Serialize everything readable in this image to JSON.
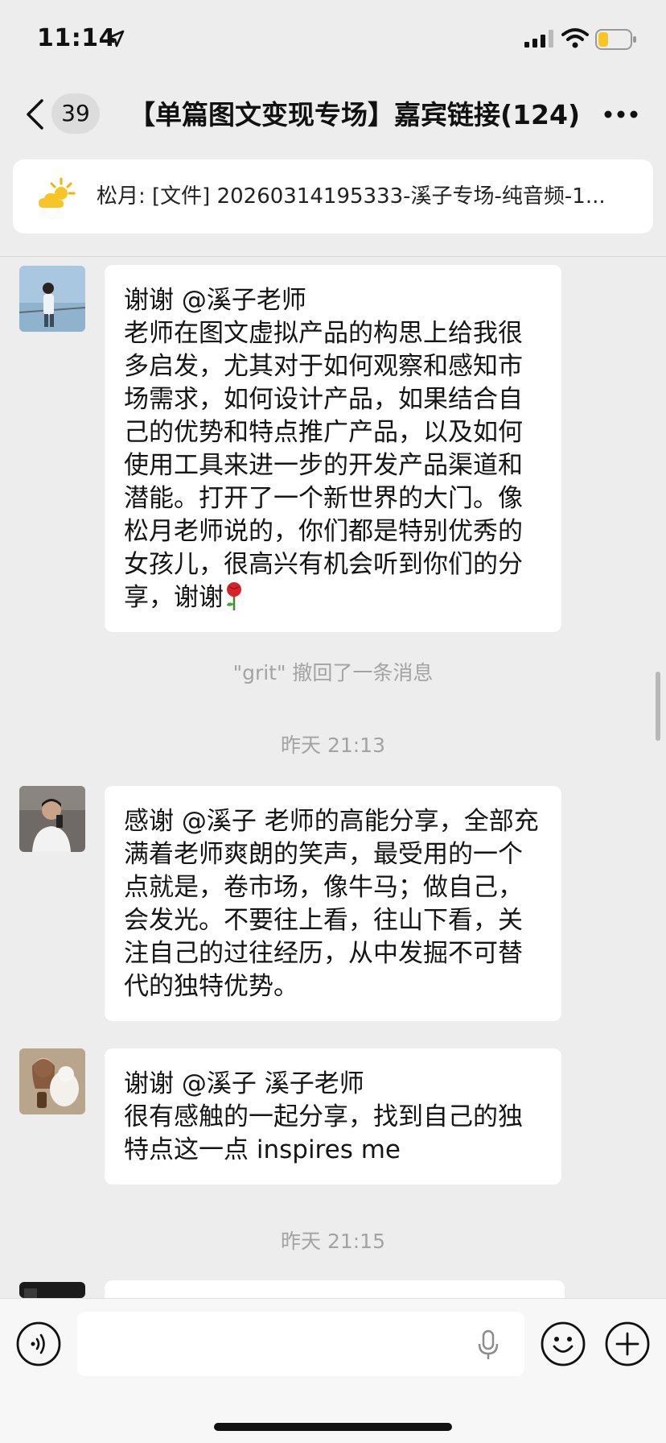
{
  "status_bar": {
    "time": "11:14"
  },
  "nav": {
    "unread_count": "39",
    "title": "【单篇图文变现专场】嘉宾链接(124)"
  },
  "notice": {
    "text": "松月: [文件] 20260314195333-溪子专场-纯音频-1..."
  },
  "messages": [
    {
      "type": "text",
      "text": "谢谢 @溪子老师\n老师在图文虚拟产品的构思上给我很多启发，尤其对于如何观察和感知市场需求，如何设计产品，如果结合自己的优势和特点推广产品，以及如何使用工具来进一步的开发产品渠道和潜能。打开了一个新世界的大门。像松月老师说的，你们都是特别优秀的女孩儿，很高兴有机会听到你们的分享，谢谢"
    },
    {
      "type": "system",
      "text": "\"grit\" 撤回了一条消息"
    },
    {
      "type": "time",
      "text": "昨天 21:13"
    },
    {
      "type": "text",
      "text": "感谢 @溪子 老师的高能分享，全部充满着老师爽朗的笑声，最受用的一个点就是，卷市场，像牛马；做自己，会发光。不要往上看，往山下看，关注自己的过往经历，从中发掘不可替代的独特优势。"
    },
    {
      "type": "text",
      "text": "谢谢 @溪子 溪子老师\n很有感触的一起分享，找到自己的独特点这一点 inspires me"
    },
    {
      "type": "time",
      "text": "昨天 21:15"
    }
  ],
  "icons": {
    "back": "chevron-left-icon",
    "more": "ellipsis-icon",
    "notice": "sun-cloud-icon",
    "voice": "voice-icon",
    "mic": "mic-icon",
    "emoji": "emoji-icon",
    "plus": "plus-icon"
  },
  "colors": {
    "background": "#ededed",
    "bubble": "#ffffff",
    "system_text": "#a3a3a3"
  }
}
